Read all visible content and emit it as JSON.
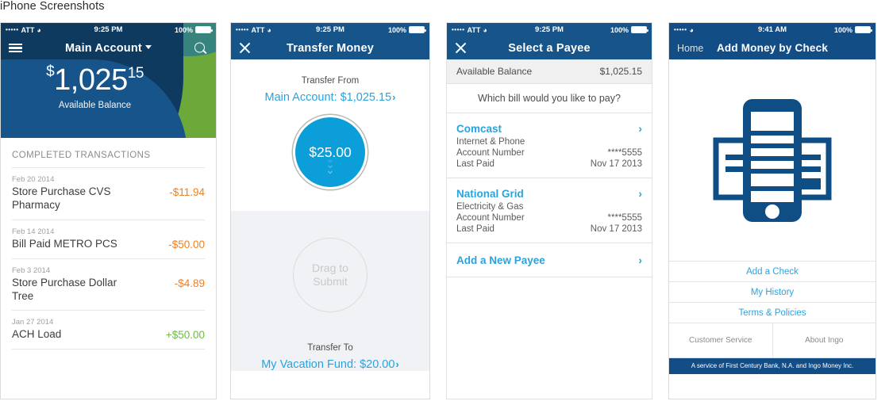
{
  "page": {
    "heading": "iPhone Screenshots"
  },
  "colors": {
    "navy": "#0e3a5f",
    "blue": "#17548a",
    "blue_dark": "#134d86",
    "cyan": "#2aa3dd",
    "circle_blue": "#0b9ed9",
    "green": "#7cbb42",
    "orange": "#f08020",
    "gray_panel": "#f0f2f5"
  },
  "screens": [
    {
      "id": "main-account",
      "status": {
        "dots": "•••••",
        "carrier": "ATT",
        "wifi": "wifi-icon",
        "time": "9:25 PM",
        "battery_pct": "100%"
      },
      "nav": {
        "menu_icon": "hamburger-icon",
        "title": "Main Account",
        "caret": "chevron-down-icon",
        "search_icon": "search-icon"
      },
      "balance": {
        "currency": "$",
        "dollars": "1,025",
        "cents": "15",
        "label": "Available Balance"
      },
      "transactions_header": "COMPLETED TRANSACTIONS",
      "transactions": [
        {
          "date": "Feb 20 2014",
          "name": "Store Purchase CVS Pharmacy",
          "amount": "-$11.94",
          "sign": "neg"
        },
        {
          "date": "Feb 14 2014",
          "name": "Bill Paid METRO PCS",
          "amount": "-$50.00",
          "sign": "neg"
        },
        {
          "date": "Feb 3 2014",
          "name": "Store Purchase Dollar Tree",
          "amount": "-$4.89",
          "sign": "neg"
        },
        {
          "date": "Jan 27 2014",
          "name": "ACH Load",
          "amount": "+$50.00",
          "sign": "pos"
        }
      ]
    },
    {
      "id": "transfer-money",
      "status": {
        "dots": "•••••",
        "carrier": "ATT",
        "wifi": "wifi-icon",
        "time": "9:25 PM",
        "battery_pct": "100%"
      },
      "nav": {
        "close_icon": "close-icon",
        "title": "Transfer Money"
      },
      "transfer_from_label": "Transfer From",
      "transfer_from_value": "Main Account: $1,025.15",
      "amount": "$25.00",
      "drag_label": "Drag to Submit",
      "transfer_to_label": "Transfer To",
      "transfer_to_value": "My Vacation Fund: $20.00",
      "chevron": "›"
    },
    {
      "id": "select-a-payee",
      "status": {
        "dots": "•••••",
        "carrier": "ATT",
        "wifi": "wifi-icon",
        "time": "9:25 PM",
        "battery_pct": "100%"
      },
      "nav": {
        "close_icon": "close-icon",
        "title": "Select a Payee"
      },
      "available_balance_label": "Available Balance",
      "available_balance_value": "$1,025.15",
      "prompt": "Which bill would you like to pay?",
      "account_number_label": "Account Number",
      "last_paid_label": "Last Paid",
      "payees": [
        {
          "name": "Comcast",
          "category": "Internet & Phone",
          "account_number": "****5555",
          "last_paid": "Nov 17 2013"
        },
        {
          "name": "National Grid",
          "category": "Electricity & Gas",
          "account_number": "****5555",
          "last_paid": "Nov 17 2013"
        }
      ],
      "add_payee": "Add a New Payee",
      "chevron": "›"
    },
    {
      "id": "add-money-by-check",
      "status": {
        "dots": "•••••",
        "carrier": "",
        "wifi": "wifi-icon",
        "time": "9:41 AM",
        "battery_pct": "100%"
      },
      "nav": {
        "back_label": "Home",
        "title": "Add Money by Check"
      },
      "hero_icon": "phone-with-check-icon",
      "menu": [
        {
          "label": "Add a Check"
        },
        {
          "label": "My History"
        },
        {
          "label": "Terms & Policies"
        }
      ],
      "sub_menu": [
        {
          "label": "Customer Service"
        },
        {
          "label": "About Ingo"
        }
      ],
      "footer": "A service of First Century Bank, N.A. and Ingo Money Inc."
    }
  ]
}
